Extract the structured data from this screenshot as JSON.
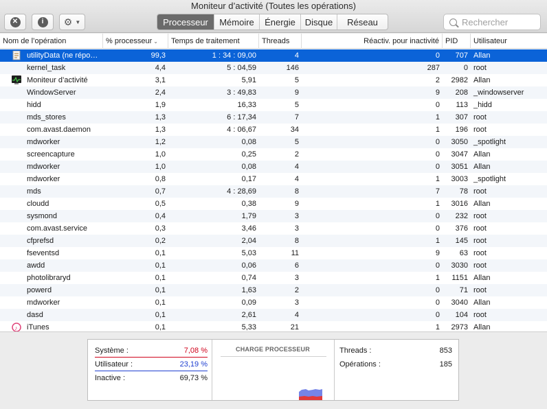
{
  "window": {
    "title": "Moniteur d’activité (Toutes les opérations)"
  },
  "toolbar": {
    "stop_icon": "close-icon",
    "info_label": "i",
    "gear_icon": "gear-icon"
  },
  "tabs": [
    {
      "label": "Processeur",
      "active": true
    },
    {
      "label": "Mémoire",
      "active": false
    },
    {
      "label": "Énergie",
      "active": false
    },
    {
      "label": "Disque",
      "active": false
    },
    {
      "label": "Réseau",
      "active": false
    }
  ],
  "search": {
    "placeholder": "Rechercher"
  },
  "columns": {
    "name": "Nom de l’opération",
    "cpu": "% processeur",
    "time": "Temps de traitement",
    "threads": "Threads",
    "wakeups": "Réactiv. pour inactivité",
    "pid": "PID",
    "user": "Utilisateur"
  },
  "processes": [
    {
      "name": "utilityData (ne répo…",
      "cpu": "99,3",
      "time": "1 : 34 : 09,00",
      "threads": "4",
      "wakeups": "0",
      "pid": "707",
      "user": "Allan",
      "icon": "document-icon",
      "selected": true
    },
    {
      "name": "kernel_task",
      "cpu": "4,4",
      "time": "5 : 04,59",
      "threads": "146",
      "wakeups": "287",
      "pid": "0",
      "user": "root"
    },
    {
      "name": "Moniteur d’activité",
      "cpu": "3,1",
      "time": "5,91",
      "threads": "5",
      "wakeups": "2",
      "pid": "2982",
      "user": "Allan",
      "icon": "activity-monitor-icon"
    },
    {
      "name": "WindowServer",
      "cpu": "2,4",
      "time": "3 : 49,83",
      "threads": "9",
      "wakeups": "9",
      "pid": "208",
      "user": "_windowserver"
    },
    {
      "name": "hidd",
      "cpu": "1,9",
      "time": "16,33",
      "threads": "5",
      "wakeups": "0",
      "pid": "113",
      "user": "_hidd"
    },
    {
      "name": "mds_stores",
      "cpu": "1,3",
      "time": "6 : 17,34",
      "threads": "7",
      "wakeups": "1",
      "pid": "307",
      "user": "root"
    },
    {
      "name": "com.avast.daemon",
      "cpu": "1,3",
      "time": "4 : 06,67",
      "threads": "34",
      "wakeups": "1",
      "pid": "196",
      "user": "root"
    },
    {
      "name": "mdworker",
      "cpu": "1,2",
      "time": "0,08",
      "threads": "5",
      "wakeups": "0",
      "pid": "3050",
      "user": "_spotlight"
    },
    {
      "name": "screencapture",
      "cpu": "1,0",
      "time": "0,25",
      "threads": "2",
      "wakeups": "0",
      "pid": "3047",
      "user": "Allan"
    },
    {
      "name": "mdworker",
      "cpu": "1,0",
      "time": "0,08",
      "threads": "4",
      "wakeups": "0",
      "pid": "3051",
      "user": "Allan"
    },
    {
      "name": "mdworker",
      "cpu": "0,8",
      "time": "0,17",
      "threads": "4",
      "wakeups": "1",
      "pid": "3003",
      "user": "_spotlight"
    },
    {
      "name": "mds",
      "cpu": "0,7",
      "time": "4 : 28,69",
      "threads": "8",
      "wakeups": "7",
      "pid": "78",
      "user": "root"
    },
    {
      "name": "cloudd",
      "cpu": "0,5",
      "time": "0,38",
      "threads": "9",
      "wakeups": "1",
      "pid": "3016",
      "user": "Allan"
    },
    {
      "name": "sysmond",
      "cpu": "0,4",
      "time": "1,79",
      "threads": "3",
      "wakeups": "0",
      "pid": "232",
      "user": "root"
    },
    {
      "name": "com.avast.service",
      "cpu": "0,3",
      "time": "3,46",
      "threads": "3",
      "wakeups": "0",
      "pid": "376",
      "user": "root"
    },
    {
      "name": "cfprefsd",
      "cpu": "0,2",
      "time": "2,04",
      "threads": "8",
      "wakeups": "1",
      "pid": "145",
      "user": "root"
    },
    {
      "name": "fseventsd",
      "cpu": "0,1",
      "time": "5,03",
      "threads": "11",
      "wakeups": "9",
      "pid": "63",
      "user": "root"
    },
    {
      "name": "awdd",
      "cpu": "0,1",
      "time": "0,06",
      "threads": "6",
      "wakeups": "0",
      "pid": "3030",
      "user": "root"
    },
    {
      "name": "photolibraryd",
      "cpu": "0,1",
      "time": "0,74",
      "threads": "3",
      "wakeups": "1",
      "pid": "1151",
      "user": "Allan"
    },
    {
      "name": "powerd",
      "cpu": "0,1",
      "time": "1,63",
      "threads": "2",
      "wakeups": "0",
      "pid": "71",
      "user": "root"
    },
    {
      "name": "mdworker",
      "cpu": "0,1",
      "time": "0,09",
      "threads": "3",
      "wakeups": "0",
      "pid": "3040",
      "user": "Allan"
    },
    {
      "name": "dasd",
      "cpu": "0,1",
      "time": "2,61",
      "threads": "4",
      "wakeups": "0",
      "pid": "104",
      "user": "root"
    },
    {
      "name": "iTunes",
      "cpu": "0,1",
      "time": "5,33",
      "threads": "21",
      "wakeups": "1",
      "pid": "2973",
      "user": "Allan",
      "icon": "itunes-icon"
    }
  ],
  "summary": {
    "system_label": "Système :",
    "system_value": "7,08 %",
    "user_label": "Utilisateur :",
    "user_value": "23,19 %",
    "idle_label": "Inactive :",
    "idle_value": "69,73 %",
    "chart_title": "CHARGE PROCESSEUR",
    "threads_label": "Threads :",
    "threads_value": "853",
    "processes_label": "Opérations :",
    "processes_value": "185",
    "colors": {
      "system": "#d0021b",
      "user": "#1f3fd1",
      "selection": "#0b63d8"
    }
  }
}
